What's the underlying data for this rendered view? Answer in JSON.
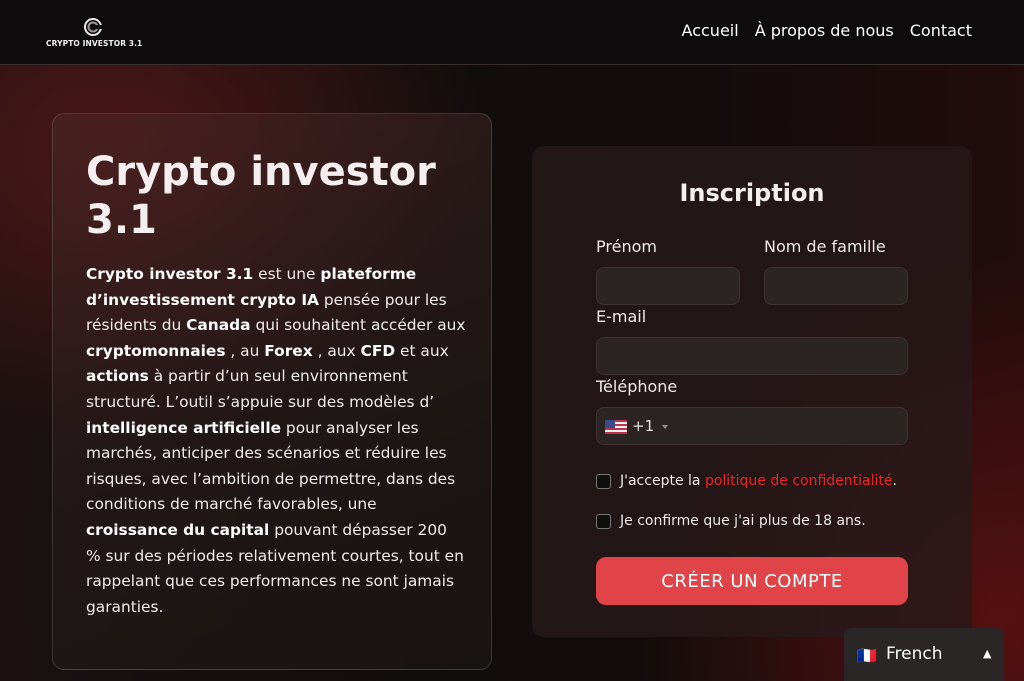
{
  "header": {
    "logo_text": "CRYPTO INVESTOR 3.1",
    "nav": [
      "Accueil",
      "À propos de nous",
      "Contact"
    ]
  },
  "info": {
    "title": "Crypto investor 3.1",
    "body": [
      {
        "t": "Crypto investor 3.1",
        "b": true
      },
      {
        "t": " est une ",
        "b": false
      },
      {
        "t": "plateforme d’investissement crypto IA",
        "b": true
      },
      {
        "t": " pensée pour les résidents du ",
        "b": false
      },
      {
        "t": "Canada",
        "b": true
      },
      {
        "t": " qui souhaitent accéder aux ",
        "b": false
      },
      {
        "t": "cryptomonnaies",
        "b": true
      },
      {
        "t": " , au ",
        "b": false
      },
      {
        "t": "Forex",
        "b": true
      },
      {
        "t": " , aux ",
        "b": false
      },
      {
        "t": "CFD",
        "b": true
      },
      {
        "t": " et aux ",
        "b": false
      },
      {
        "t": "actions",
        "b": true
      },
      {
        "t": " à partir d’un seul environnement structuré. L’outil s’appuie sur des modèles d’ ",
        "b": false
      },
      {
        "t": "intelligence artificielle",
        "b": true
      },
      {
        "t": " pour analyser les marchés, anticiper des scénarios et réduire les risques, avec l’ambition de permettre, dans des conditions de marché favorables, une ",
        "b": false
      },
      {
        "t": "croissance du capital",
        "b": true
      },
      {
        "t": " pouvant dépasser 200 % sur des périodes relativement courtes, tout en rappelant que ces performances ne sont jamais garanties.",
        "b": false
      }
    ]
  },
  "form": {
    "title": "Inscription",
    "first_name_label": "Prénom",
    "first_name_value": "",
    "last_name_label": "Nom de famille",
    "last_name_value": "",
    "email_label": "E-mail",
    "email_value": "",
    "phone_label": "Téléphone",
    "phone_dial_code": "+1",
    "phone_country": "us-flag-icon",
    "phone_value": "",
    "privacy_prefix": "J'accepte la ",
    "privacy_link": "politique de confidentialité",
    "privacy_suffix": ".",
    "privacy_checked": false,
    "age_text": "Je confirme que j'ai plus de 18 ans.",
    "age_checked": false,
    "submit_label": "CRÉER UN COMPTE"
  },
  "language": {
    "flag_text": "🇫🇷",
    "label": "French",
    "arrow": "▲"
  },
  "colors": {
    "accent_button": "#e04448",
    "link": "#e8252c",
    "header_bg": "#0d0b0b"
  }
}
